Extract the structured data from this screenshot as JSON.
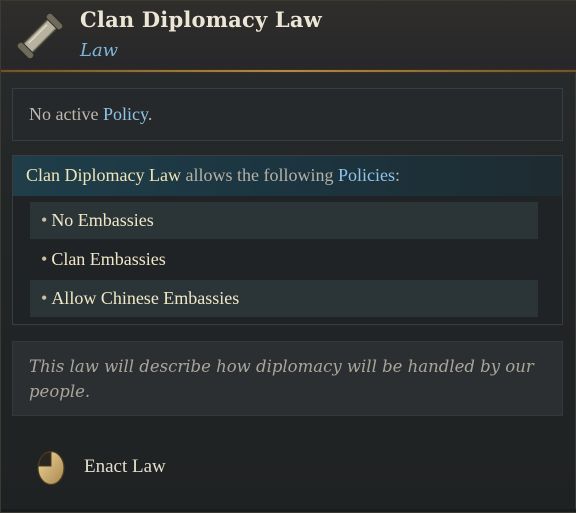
{
  "header": {
    "title": "Clan Diplomacy Law",
    "subtitle": "Law",
    "icon": "scroll-icon"
  },
  "active_policy": {
    "prefix": "No active ",
    "keyword": "Policy",
    "suffix": "."
  },
  "policies": {
    "law_name": "Clan Diplomacy Law",
    "middle_text": " allows the following ",
    "keyword": "Policies",
    "suffix": ":",
    "bullet": "•",
    "items": [
      {
        "label": "No Embassies"
      },
      {
        "label": "Clan Embassies"
      },
      {
        "label": "Allow Chinese Embassies"
      }
    ]
  },
  "description": "This law will describe how diplomacy will be handled by our people.",
  "action": {
    "icon": "mouse-left-click-icon",
    "label": "Enact Law"
  },
  "colors": {
    "keyword_blue": "#8fc4e8",
    "gold_text": "#efe3b8",
    "header_rule": "#b08a4a"
  }
}
